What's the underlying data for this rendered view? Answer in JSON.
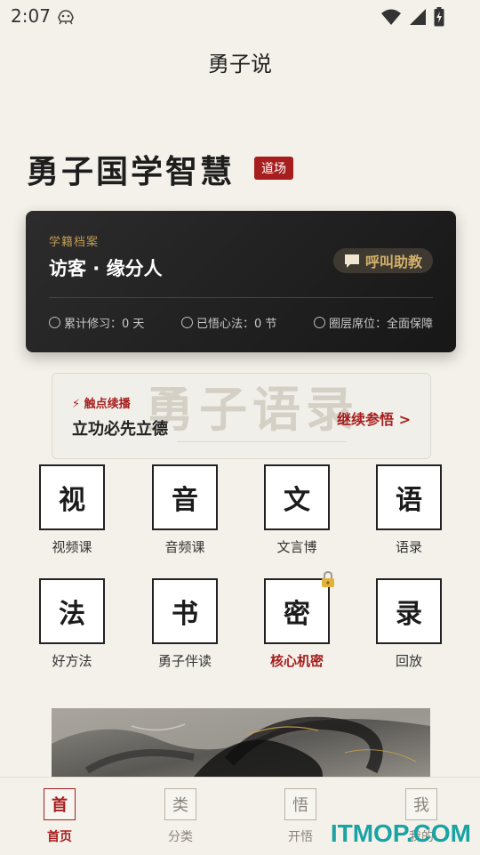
{
  "status": {
    "time": "2:07"
  },
  "header": {
    "title": "勇子说"
  },
  "hero": {
    "title": "勇子国学智慧",
    "badge": "道场"
  },
  "profile": {
    "label": "学籍档案",
    "name": "访客 · 缘分人",
    "call_button": "呼叫助教",
    "stats": [
      "累计修习：0 天",
      "已悟心法：0 节",
      "圈层席位：全面保障"
    ]
  },
  "continue": {
    "tag": "⚡ 触点续播",
    "title": "立功必先立德",
    "link": "继续参悟 >",
    "watermark": "勇子语录"
  },
  "grid": [
    {
      "char": "视",
      "label": "视频课"
    },
    {
      "char": "音",
      "label": "音频课"
    },
    {
      "char": "文",
      "label": "文言博"
    },
    {
      "char": "语",
      "label": "语录"
    },
    {
      "char": "法",
      "label": "好方法"
    },
    {
      "char": "书",
      "label": "勇子伴读"
    },
    {
      "char": "密",
      "label": "核心机密"
    },
    {
      "char": "录",
      "label": "回放"
    }
  ],
  "tabs": [
    {
      "char": "首",
      "label": "首页"
    },
    {
      "char": "类",
      "label": "分类"
    },
    {
      "char": "悟",
      "label": "开悟"
    },
    {
      "char": "我",
      "label": "我的"
    }
  ],
  "watermark": "ITMOP.COM",
  "colors": {
    "accent": "#a61e1e",
    "gold": "#c09a54",
    "card_bg": "#1f1f1f",
    "page_bg": "#f4f1ea"
  }
}
